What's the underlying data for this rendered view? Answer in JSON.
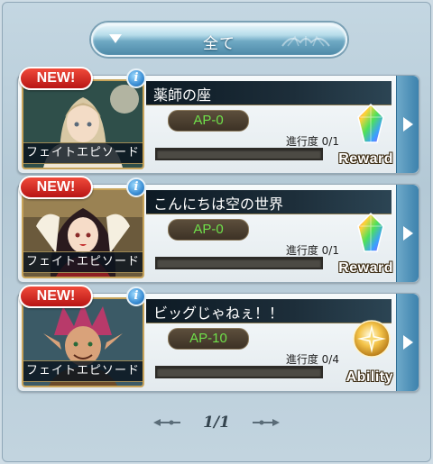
{
  "filter": {
    "label": "全て"
  },
  "quests": [
    {
      "new_badge": "NEW!",
      "info": "i",
      "category": "フェイトエピソード",
      "title": "薬師の座",
      "ap": "AP-0",
      "progress_label": "進行度 0/1",
      "progress": 0,
      "reward_label": "Reward",
      "reward_icon": "rainbow-crystal-icon"
    },
    {
      "new_badge": "NEW!",
      "info": "i",
      "category": "フェイトエピソード",
      "title": "こんにちは空の世界",
      "ap": "AP-0",
      "progress_label": "進行度 0/1",
      "progress": 0,
      "reward_label": "Reward",
      "reward_icon": "rainbow-crystal-icon"
    },
    {
      "new_badge": "NEW!",
      "info": "i",
      "category": "フェイトエピソード",
      "title": "ビッグじゃねぇ！！",
      "ap": "AP-10",
      "progress_label": "進行度 0/4",
      "progress": 0,
      "reward_label": "Ability",
      "reward_icon": "ability-star-icon"
    }
  ],
  "pager": {
    "text": "1/1"
  },
  "colors": {
    "ap_text": "#6fe04a",
    "new_badge": "#d42a22",
    "row_button": "#3d82ad"
  }
}
